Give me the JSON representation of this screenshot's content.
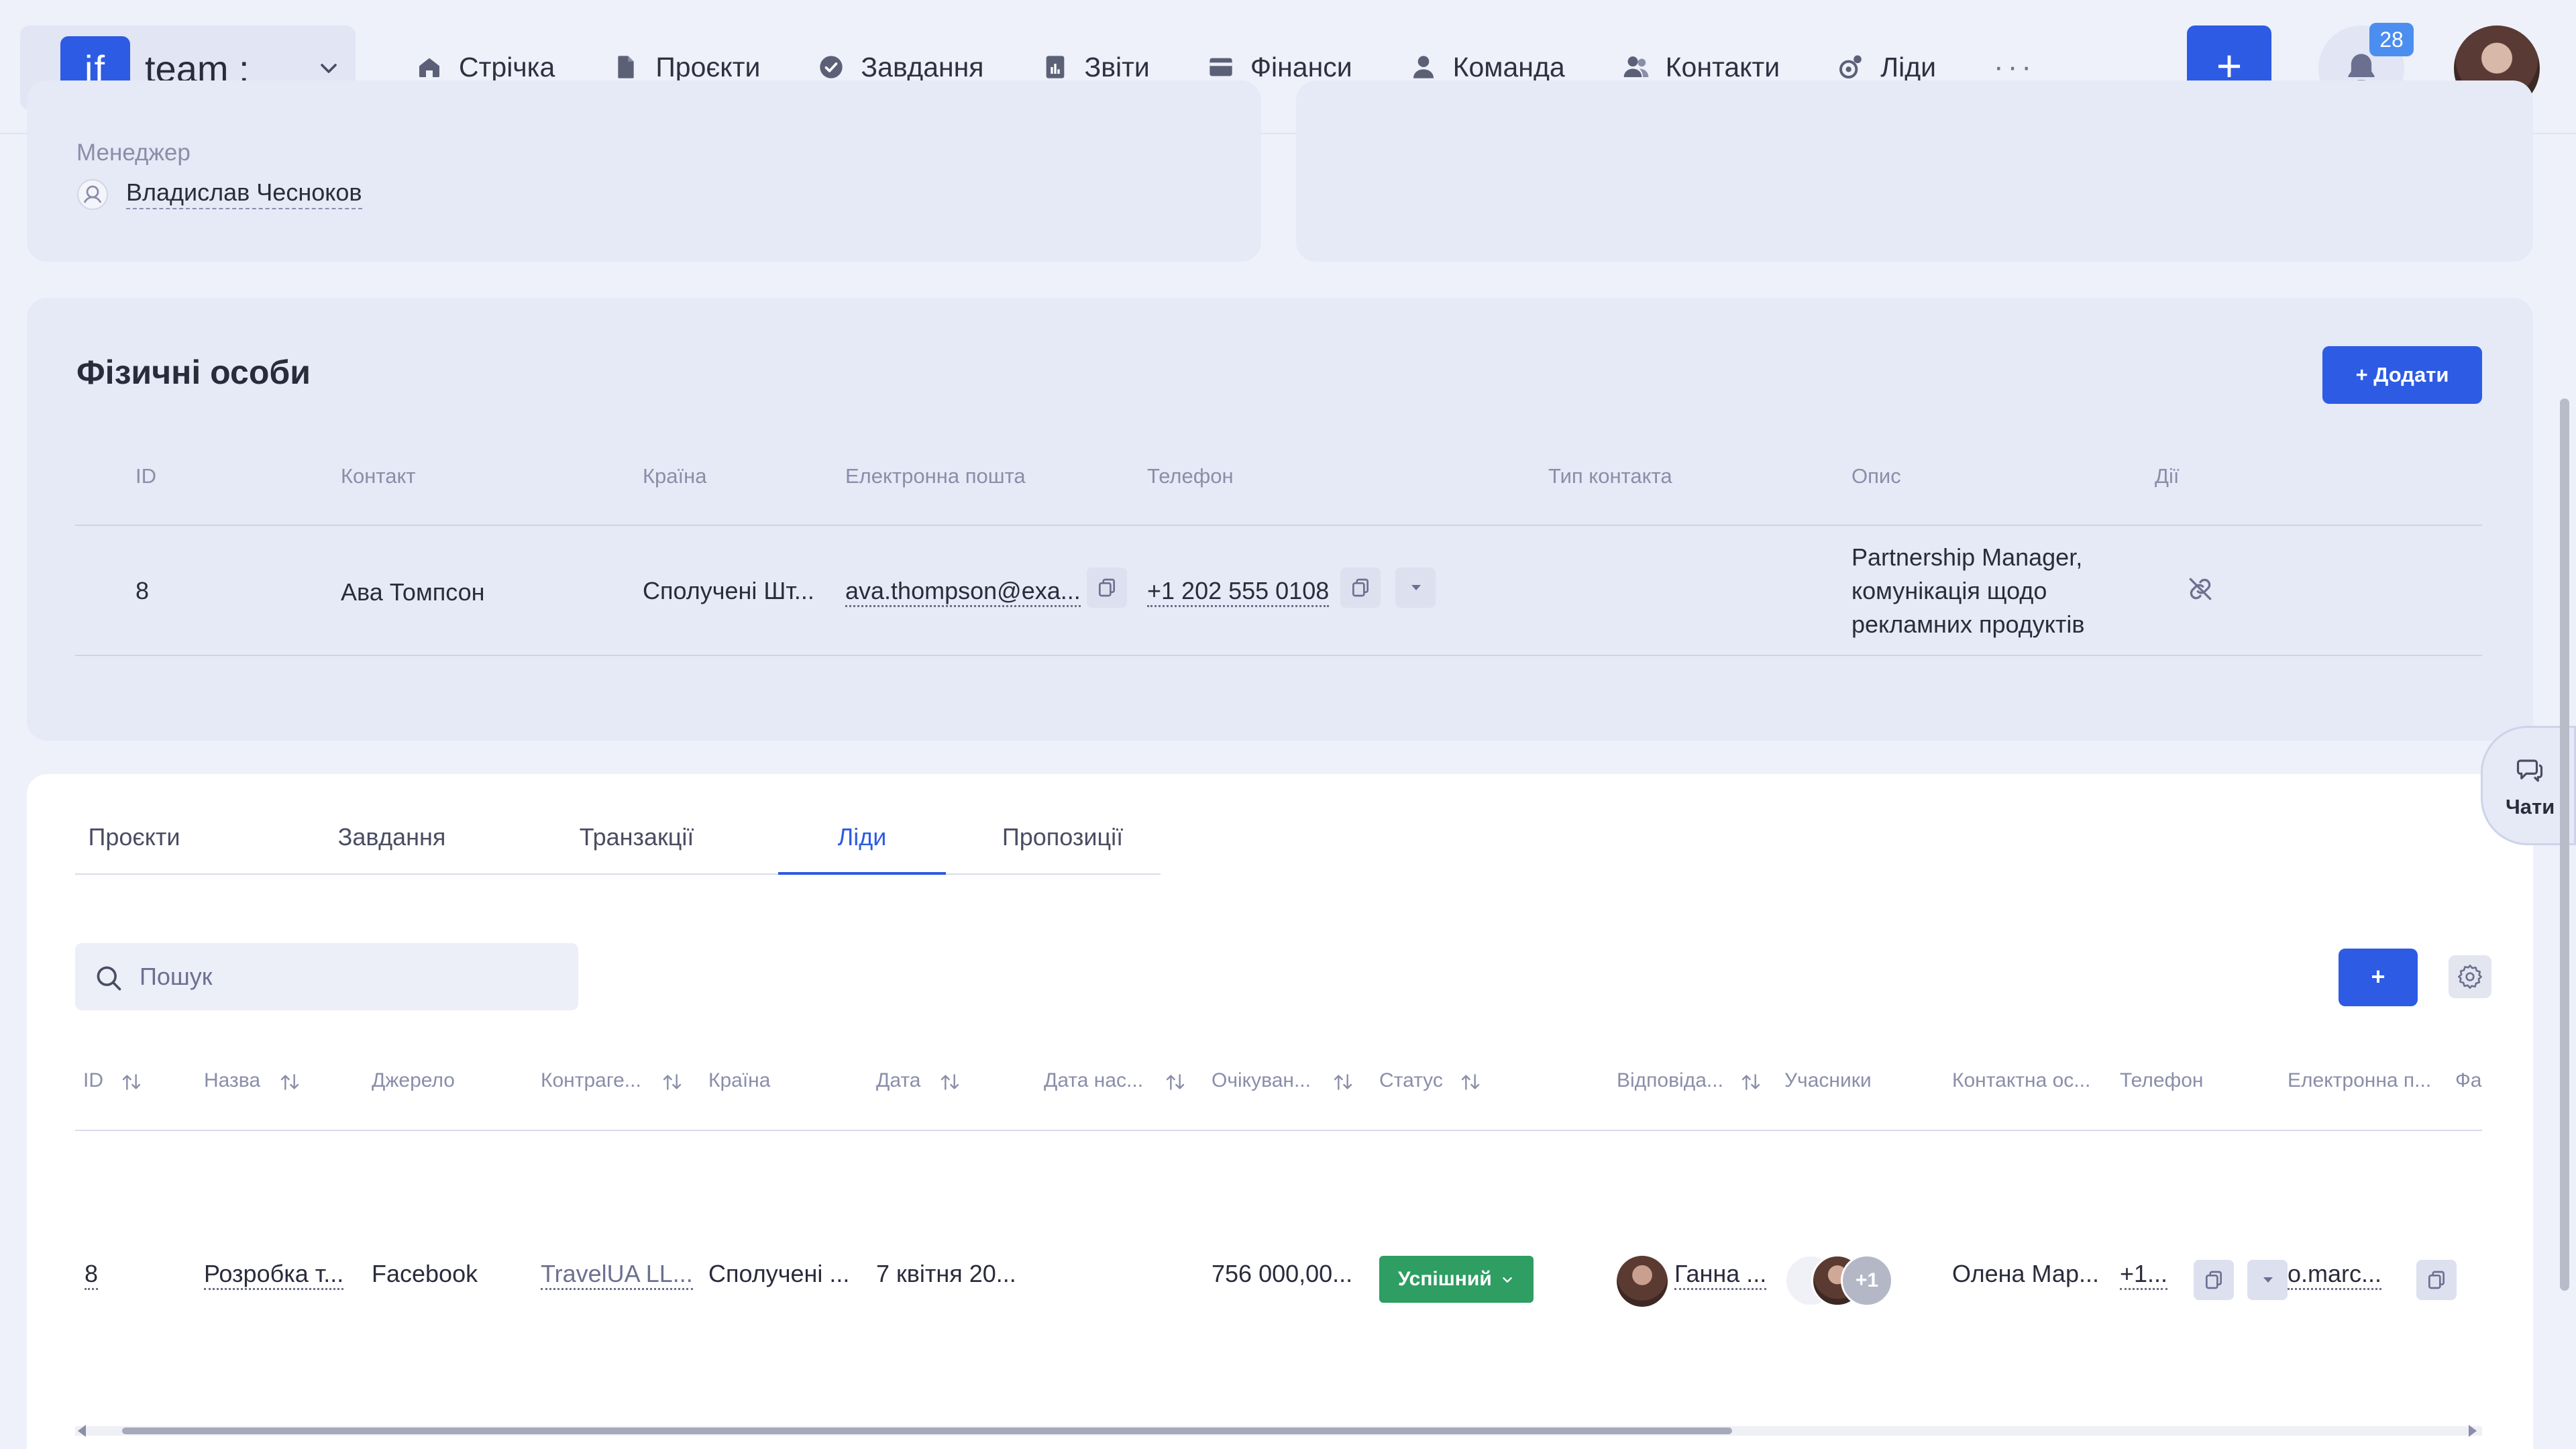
{
  "header": {
    "logo_text": "if",
    "team_name": "team :",
    "nav": [
      {
        "label": "Стрічка",
        "icon": "home-icon"
      },
      {
        "label": "Проєкти",
        "icon": "document-icon"
      },
      {
        "label": "Завдання",
        "icon": "check-circle-icon"
      },
      {
        "label": "Звіти",
        "icon": "report-icon"
      },
      {
        "label": "Фінанси",
        "icon": "wallet-icon"
      },
      {
        "label": "Команда",
        "icon": "person-icon"
      },
      {
        "label": "Контакти",
        "icon": "contacts-icon"
      },
      {
        "label": "Ліди",
        "icon": "leads-icon"
      }
    ],
    "more_label": "···",
    "create_label": "+",
    "notifications_count": "28"
  },
  "manager_card": {
    "label": "Менеджер",
    "name": "Владислав Чесноков"
  },
  "persons": {
    "title": "Фізичні особи",
    "add_label": "+ Додати",
    "columns": [
      "ID",
      "Контакт",
      "Країна",
      "Електронна пошта",
      "Телефон",
      "Тип контакта",
      "Опис",
      "Дії"
    ],
    "row": {
      "id": "8",
      "contact": "Ава Томпсон",
      "country": "Сполучені Шт...",
      "email": "ava.thompson@exa...",
      "phone": "+1 202 555 0108",
      "type": "",
      "description": "Partnership Manager, комунікація щодо рекламних продуктів"
    }
  },
  "tabs": [
    {
      "label": "Проєкти",
      "active": false
    },
    {
      "label": "Завдання",
      "active": false
    },
    {
      "label": "Транзакції",
      "active": false
    },
    {
      "label": "Ліди",
      "active": true
    },
    {
      "label": "Пропозиції",
      "active": false
    }
  ],
  "search": {
    "placeholder": "Пошук",
    "value": ""
  },
  "leads_table": {
    "add_label": "+",
    "columns": [
      "ID",
      "Назва",
      "Джерело",
      "Контраге...",
      "Країна",
      "Дата",
      "Дата нас...",
      "Очікуван...",
      "Статус",
      "Відповіда...",
      "Учасники",
      "Контактна ос...",
      "Телефон",
      "Електронна п...",
      "Фа"
    ],
    "row": {
      "id": "8",
      "name": "Розробка т...",
      "source": "Facebook",
      "counterparty": "TravelUA LL...",
      "country": "Сполучені ...",
      "date": "7 квітня 20...",
      "next_date": "",
      "expected": "756 000,00...",
      "status": "Успішний",
      "responsible": "Ганна ...",
      "members_extra": "+1",
      "contact_person": "Олена Мар...",
      "phone": "+1...",
      "email": "o.marc..."
    }
  },
  "chat": {
    "label": "Чати"
  },
  "colors": {
    "accent": "#2d5be3",
    "success": "#2e9e63",
    "background": "#eef0fa",
    "card": "#e6e9f6"
  }
}
